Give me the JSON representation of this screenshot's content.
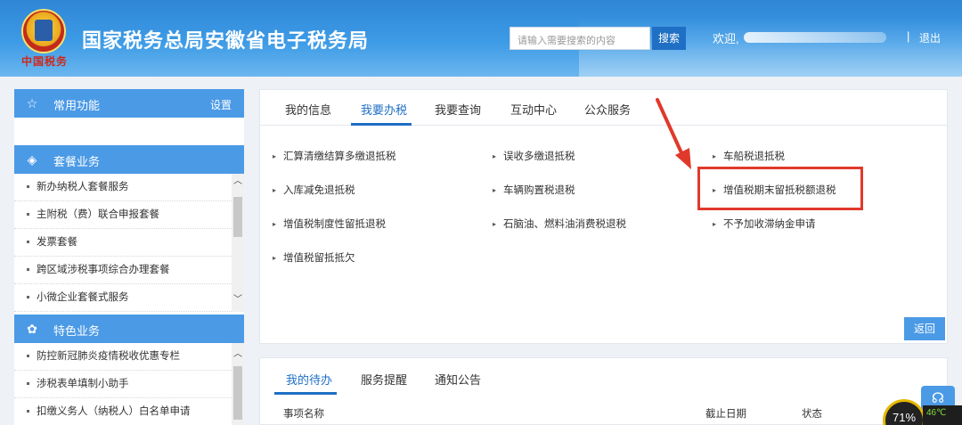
{
  "header": {
    "emblem_tag": "中国税务",
    "title": "国家税务总局安徽省电子税务局",
    "search_placeholder": "请输入需要搜索的内容",
    "search_button": "搜索",
    "welcome": "欢迎,",
    "separator": "|",
    "logout": "退出"
  },
  "sidebar": {
    "common": {
      "icon": "star-icon",
      "title": "常用功能",
      "settings": "设置"
    },
    "package": {
      "icon": "layers-icon",
      "title": "套餐业务",
      "items": [
        "新办纳税人套餐服务",
        "主附税（费）联合申报套餐",
        "发票套餐",
        "跨区域涉税事项综合办理套餐",
        "小微企业套餐式服务"
      ]
    },
    "special": {
      "icon": "clover-icon",
      "title": "特色业务",
      "items": [
        "防控新冠肺炎疫情税收优惠专栏",
        "涉税表单填制小助手",
        "扣缴义务人（纳税人）白名单申请"
      ]
    }
  },
  "main": {
    "tabs": [
      "我的信息",
      "我要办税",
      "我要查询",
      "互动中心",
      "公众服务"
    ],
    "active_tab": "我要办税",
    "services": {
      "col1": [
        "汇算清缴结算多缴退抵税",
        "入库减免退抵税",
        "增值税制度性留抵退税",
        "增值税留抵抵欠"
      ],
      "col2": [
        "误收多缴退抵税",
        "车辆购置税退税",
        "石脑油、燃料油消费税退税"
      ],
      "col3": [
        "车船税退抵税",
        "增值税期末留抵税额退税",
        "不予加收滞纳金申请"
      ]
    },
    "highlighted_item": "增值税期末留抵税额退税",
    "back_button": "返回"
  },
  "lower": {
    "tabs": [
      "我的待办",
      "服务提醒",
      "通知公告"
    ],
    "active_tab": "我的待办",
    "headers": [
      "事项名称",
      "截止日期",
      "状态"
    ]
  },
  "widgets": {
    "gauge": "71%",
    "temp": "46℃"
  },
  "colors": {
    "accent": "#1f6fc5",
    "section_header": "#4b9ae6",
    "highlight": "#e0392c"
  }
}
